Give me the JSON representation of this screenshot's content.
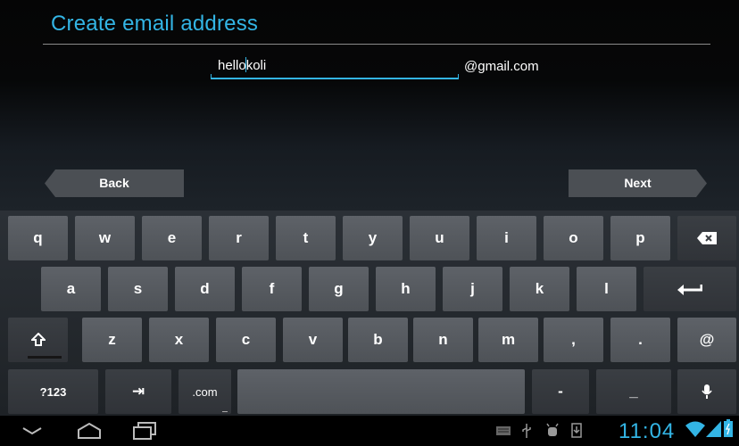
{
  "header": {
    "title": "Create email address"
  },
  "email": {
    "username": "hellokoli",
    "username_before_cursor": "hello",
    "username_after_cursor": "koli",
    "domain": "@gmail.com"
  },
  "navigation": {
    "back_label": "Back",
    "next_label": "Next"
  },
  "keyboard": {
    "row1": [
      "q",
      "w",
      "e",
      "r",
      "t",
      "y",
      "u",
      "i",
      "o",
      "p"
    ],
    "row2": [
      "a",
      "s",
      "d",
      "f",
      "g",
      "h",
      "j",
      "k",
      "l"
    ],
    "row3": [
      "z",
      "x",
      "c",
      "v",
      "b",
      "n",
      "m",
      ",",
      ".",
      "@"
    ],
    "symbols_label": "?123",
    "tab_label": "⇥",
    "dotcom_label": ".com",
    "dash_label": "-",
    "underscore_label": "_",
    "icons": {
      "backspace": "backspace-icon",
      "enter": "enter-icon",
      "shift": "shift-icon",
      "mic": "mic-icon"
    }
  },
  "status_bar": {
    "time": "11:04",
    "icons": [
      "keyboard-icon",
      "usb-icon",
      "debug-icon",
      "download-icon",
      "wifi-icon",
      "signal-icon",
      "battery-icon"
    ]
  },
  "colors": {
    "accent": "#33b5e5",
    "key": "#55595e",
    "key_dark": "#35393e",
    "background": "#000000"
  }
}
